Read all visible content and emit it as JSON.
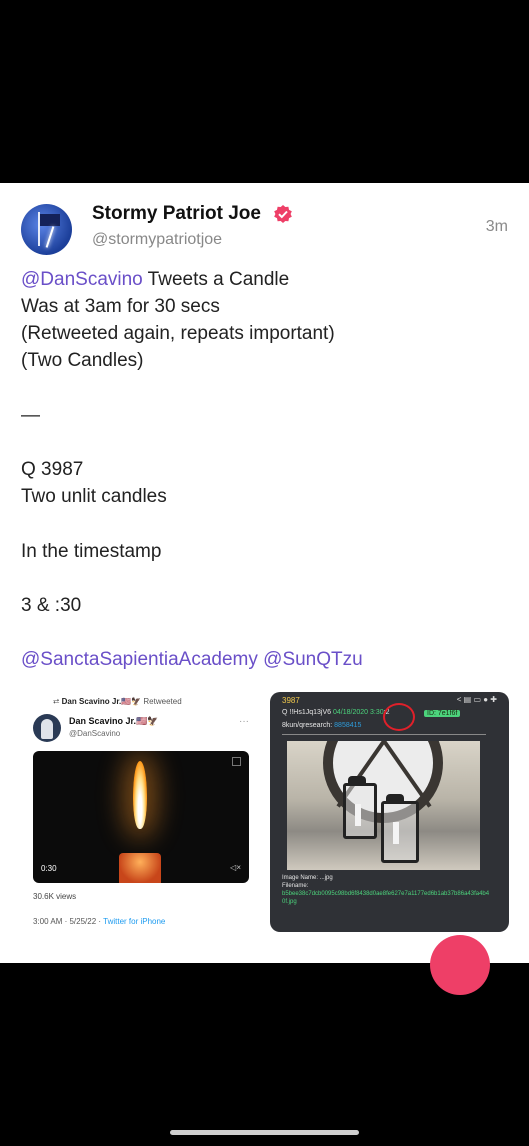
{
  "post": {
    "author_name": "Stormy Patriot Joe",
    "author_handle": "@stormypatriotjoe",
    "time_ago": "3m",
    "mention_scavino": "@DanScavino",
    "line1_rest": " Tweets a Candle",
    "line2": "Was at 3am for 30 secs",
    "line3": "(Retweeted again, repeats important)",
    "line4": "(Two Candles)",
    "separator": "—",
    "line5": "Q 3987",
    "line6": "Two unlit candles",
    "line7": "In the timestamp",
    "line8": "3 & :30",
    "mention_sancta": "@SanctaSapientiaAcademy",
    "mention_sunqtzu": "@SunQTzu",
    "accent_color": "#6a4fc8",
    "fab_color": "#ee3f67"
  },
  "image_left": {
    "retweet_label": "Dan Scavino Jr.🇺🇸🦅",
    "retweet_suffix": "Retweeted",
    "name": "Dan Scavino Jr.🇺🇸🦅",
    "handle": "@DanScavino",
    "more": "···",
    "video_time": "0:30",
    "views": "30.6K views",
    "timestamp": "3:00 AM · 5/25/22 · ",
    "source": "Twitter for iPhone"
  },
  "image_right": {
    "q_number": "3987",
    "toolbar_icons": "< ▤ ▭ ● ✚",
    "q_marker": "Q",
    "trip": "!!Hs1Jq13jV6",
    "date": "04/18/2020",
    "time": "3:30",
    "seconds": ":2",
    "post_id": "ID: 7e1f6f",
    "board": "8kun/qresearch:",
    "board_num": "8858415",
    "image_name_label": "Image Name:",
    "image_name_value": "...jpg",
    "filename_label": "Filename:",
    "filename_hash": "b5bee38c7dcb0095c98bd6f8438d0ae8fe627e7a1177ed6b1ab37b86a43fa4b40f.jpg"
  }
}
